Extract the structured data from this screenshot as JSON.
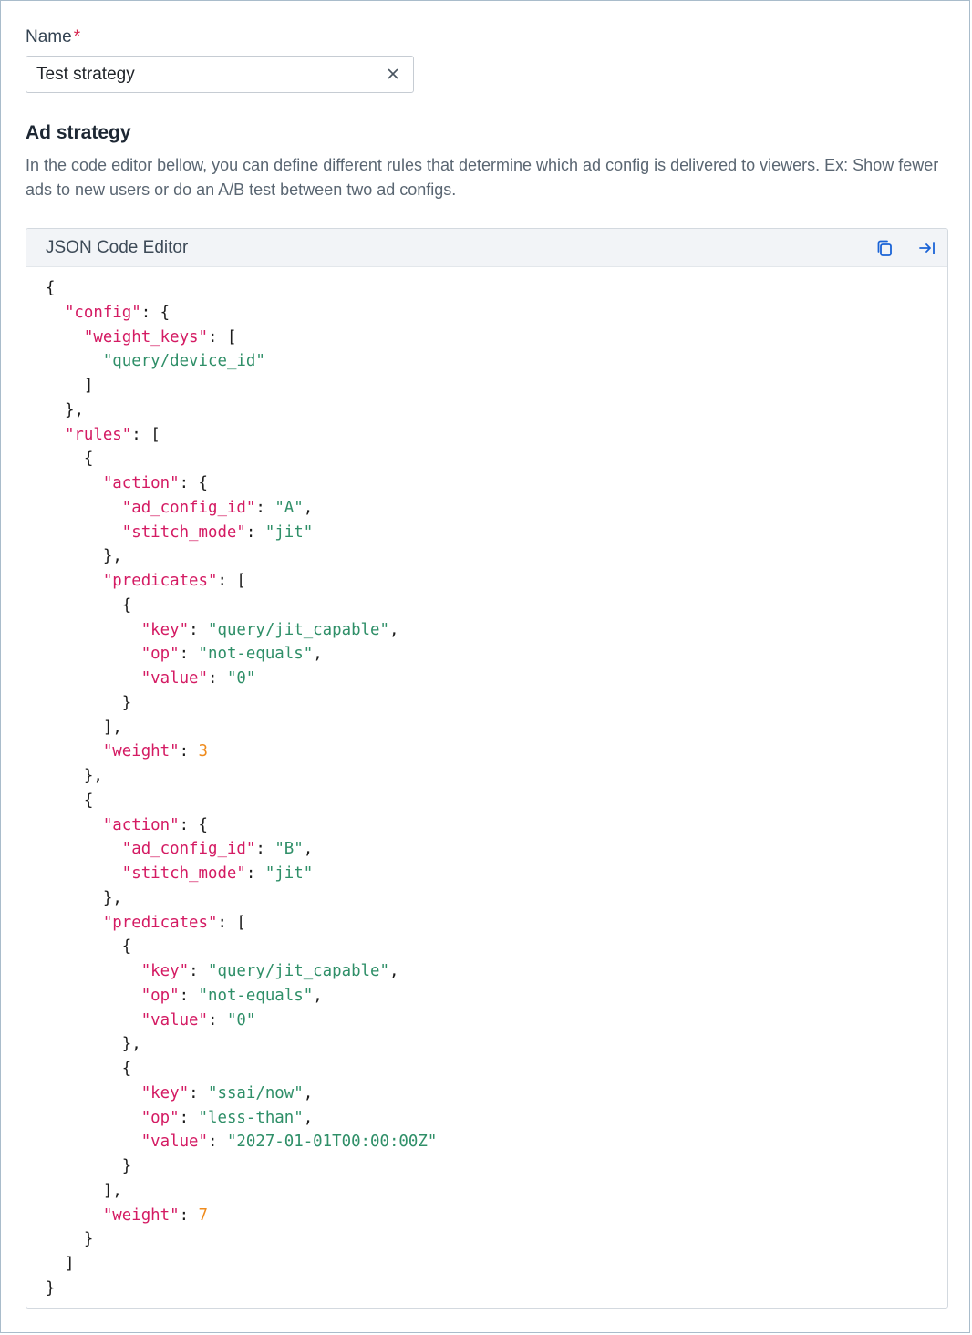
{
  "form": {
    "name_label": "Name",
    "required_mark": "*",
    "name_value": "Test strategy",
    "clear_icon": "close-icon"
  },
  "ad_strategy": {
    "title": "Ad strategy",
    "description": "In the code editor bellow, you can define different rules that determine which ad config is delivered to viewers. Ex: Show fewer ads to new users or do an A/B test between two ad configs."
  },
  "editor": {
    "title": "JSON Code Editor",
    "copy_icon": "copy-icon",
    "expand_icon": "expand-right-icon",
    "colors": {
      "key": "#d41b63",
      "string": "#2f8f68",
      "number": "#ef8b1d",
      "punctuation": "#1c1c1c"
    },
    "json": {
      "config": {
        "weight_keys": [
          "query/device_id"
        ]
      },
      "rules": [
        {
          "action": {
            "ad_config_id": "A",
            "stitch_mode": "jit"
          },
          "predicates": [
            {
              "key": "query/jit_capable",
              "op": "not-equals",
              "value": "0"
            }
          ],
          "weight": 3
        },
        {
          "action": {
            "ad_config_id": "B",
            "stitch_mode": "jit"
          },
          "predicates": [
            {
              "key": "query/jit_capable",
              "op": "not-equals",
              "value": "0"
            },
            {
              "key": "ssai/now",
              "op": "less-than",
              "value": "2027-01-01T00:00:00Z"
            }
          ],
          "weight": 7
        }
      ]
    }
  }
}
